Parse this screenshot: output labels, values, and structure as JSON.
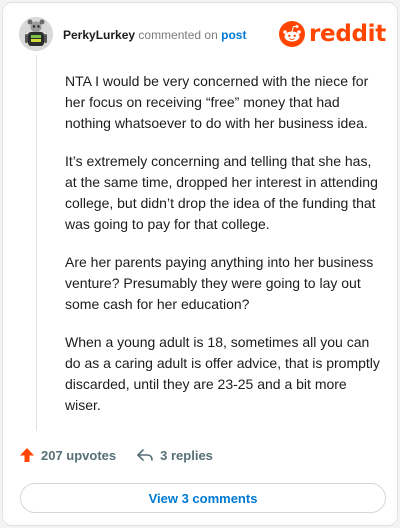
{
  "header": {
    "username": "PerkyLurkey",
    "action_text": "commented on",
    "post_link": "post"
  },
  "brand": {
    "wordmark": "reddit",
    "color": "#ff4500"
  },
  "comment": {
    "paragraphs": [
      "NTA I would be very concerned with the niece for her focus on receiving “free” money that had nothing whatsoever to do with her business idea.",
      "It’s extremely concerning and telling that she has, at the same time, dropped her interest in attending college, but didn’t drop the idea of the funding that was going to pay for that college.",
      "Are her parents paying anything into her business venture? Presumably they were going to lay out some cash for her education?",
      "When a young adult is 18, sometimes all you can do as a caring adult is offer advice, that is promptly discarded, until they are 23-25 and a bit more wiser."
    ]
  },
  "actions": {
    "upvotes_label": "207 upvotes",
    "replies_label": "3 replies",
    "upvote_icon": "upvote-arrow-icon",
    "reply_icon": "reply-arrow-icon"
  },
  "footer": {
    "view_comments_label": "View 3 comments"
  },
  "colors": {
    "link_blue": "#0079d3",
    "upvote_orange": "#ff4500",
    "muted_text": "#576f76"
  }
}
